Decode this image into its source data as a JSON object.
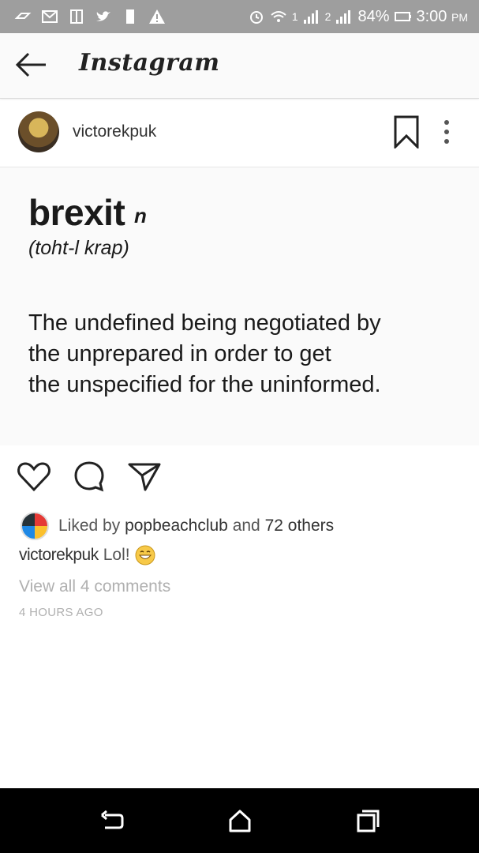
{
  "status_bar": {
    "battery_percent": "84%",
    "time": "3:00",
    "time_suffix": "PM",
    "signal_sim1": "1",
    "signal_sim2": "2"
  },
  "app_bar": {
    "title": "Instagram"
  },
  "post": {
    "username": "victorekpuk",
    "image_text": {
      "word": "brexit",
      "part_of_speech": "n",
      "pronunciation": "(toht-l krap)",
      "definition_line1": "The undefined being negotiated by",
      "definition_line2": "the unprepared in order to get",
      "definition_line3": "the unspecified for the uninformed."
    },
    "likes": {
      "prefix": "Liked by",
      "user": "popbeachclub",
      "middle": "and",
      "others": "72 others"
    },
    "caption": {
      "user": "victorekpuk",
      "text": "Lol!"
    },
    "view_all_comments": "View all 4 comments",
    "timestamp": "4 HOURS AGO"
  },
  "icons": {
    "back": "back-arrow-icon",
    "bookmark": "bookmark-icon",
    "more": "more-vertical-icon",
    "like": "heart-icon",
    "comment": "comment-icon",
    "share": "send-icon"
  }
}
